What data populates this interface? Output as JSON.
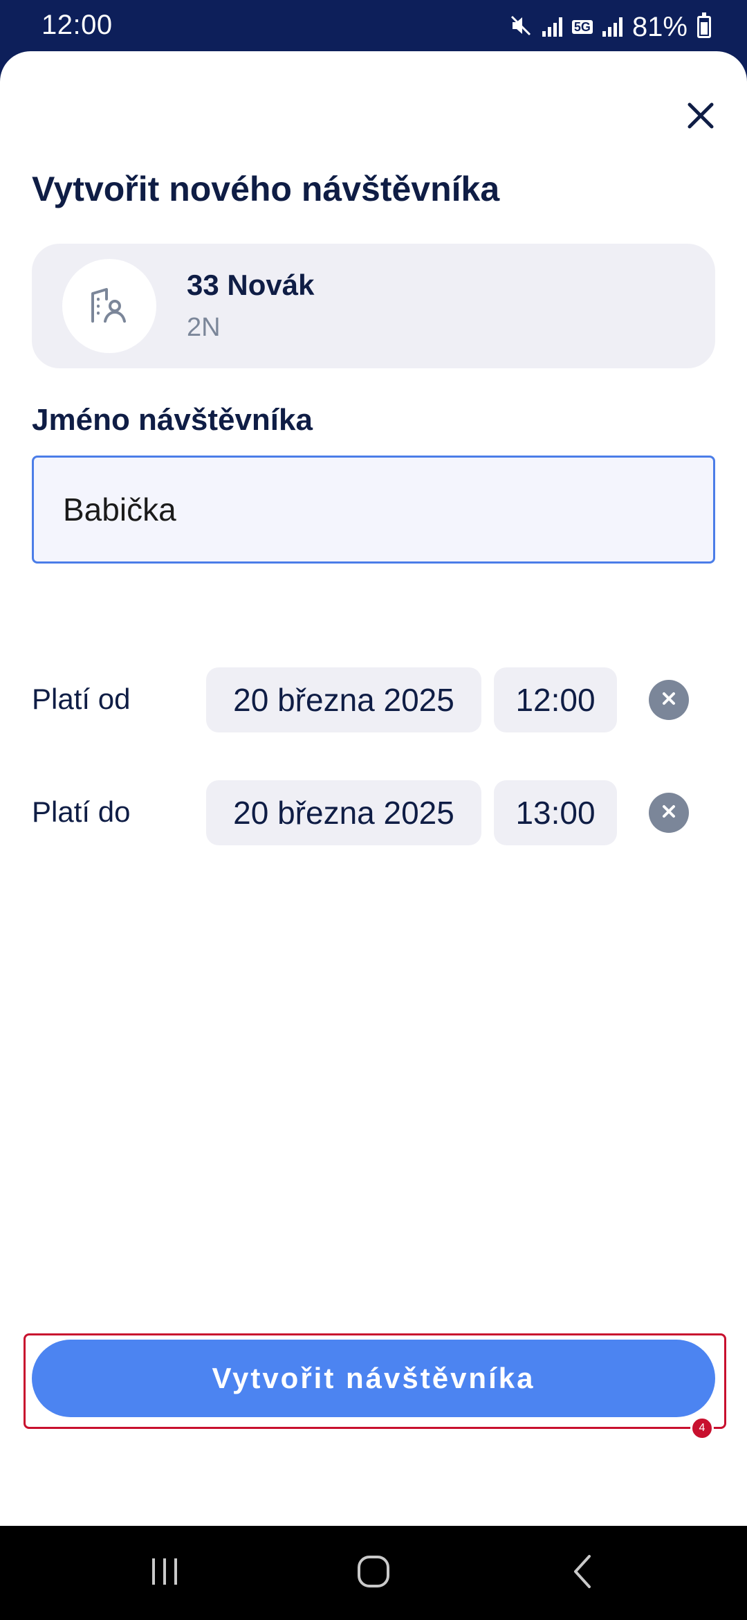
{
  "status_bar": {
    "time": "12:00",
    "battery": "81%",
    "network": "5G",
    "icons": [
      "mute-icon",
      "signal-icon",
      "network-5g-icon",
      "signal-icon",
      "battery-icon"
    ]
  },
  "sheet": {
    "title": "Vytvořit nového návštěvníka",
    "close_icon": "close-icon"
  },
  "unit": {
    "name": "33 Novák",
    "subtitle": "2N",
    "icon": "building-person-icon"
  },
  "visitor_name": {
    "label": "Jméno návštěvníka",
    "value": "Babička"
  },
  "valid_from": {
    "label": "Platí od",
    "date": "20 března 2025",
    "time": "12:00"
  },
  "valid_to": {
    "label": "Platí do",
    "date": "20 března 2025",
    "time": "13:00"
  },
  "primary_action": {
    "label": "Vytvořit návštěvníka",
    "marker": "4"
  },
  "nav_bar": {
    "icons": [
      "recent-apps-icon",
      "home-icon",
      "back-icon"
    ]
  },
  "colors": {
    "header": "#0d1f5a",
    "accent": "#4c84f1",
    "text_primary": "#0f1d45",
    "chip_bg": "#efeff5",
    "highlight": "#c8102e"
  }
}
